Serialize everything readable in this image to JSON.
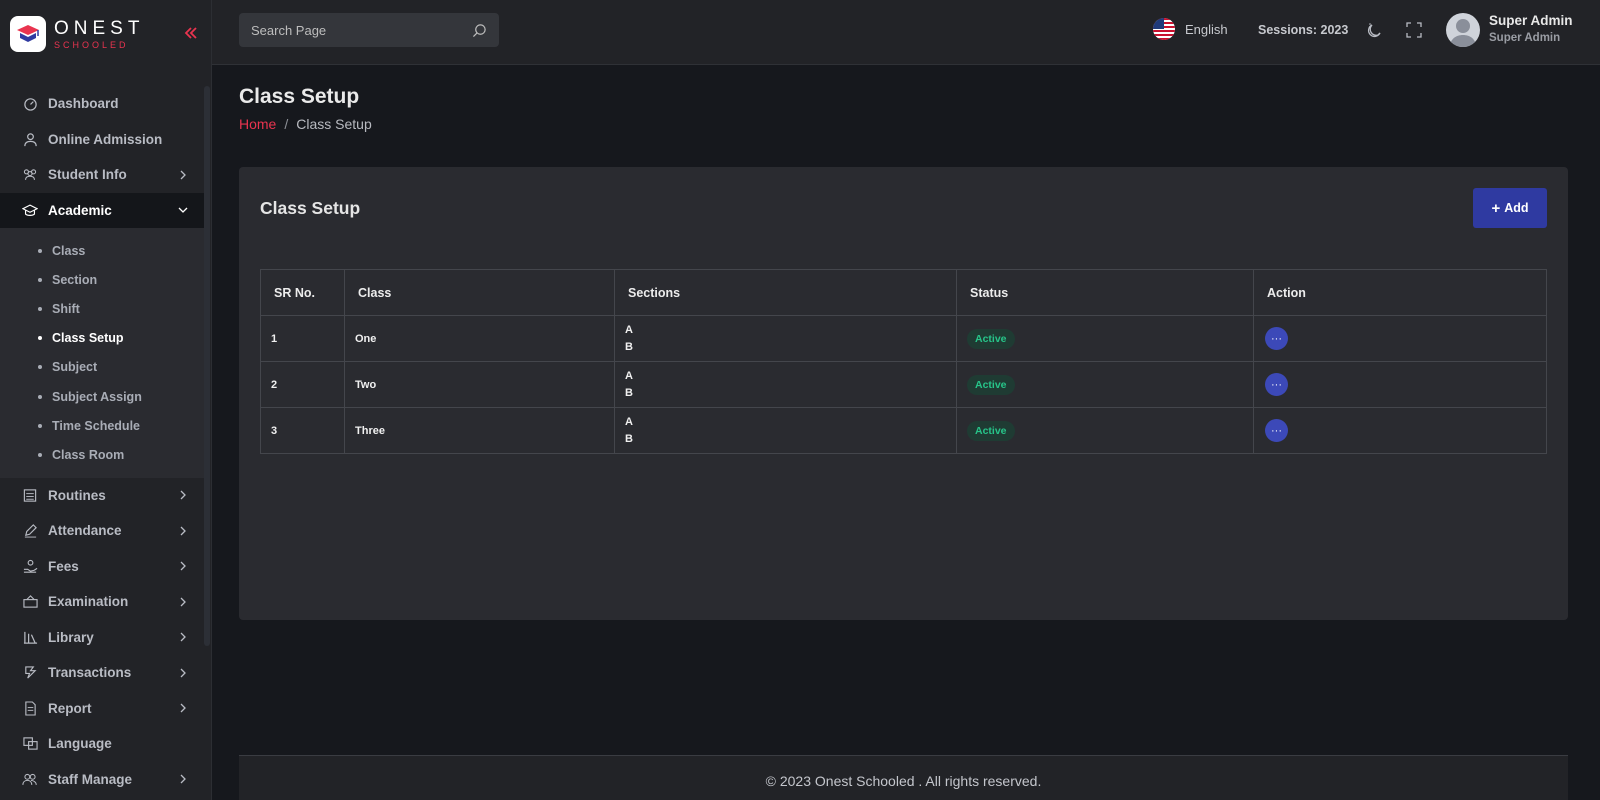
{
  "brand": {
    "name": "ONEST",
    "tagline": "SCHOOLED",
    "accent": "#e9344f"
  },
  "sidebar": {
    "items": [
      {
        "label": "Dashboard",
        "icon": "dashboard-icon",
        "has_children": false
      },
      {
        "label": "Online Admission",
        "icon": "user-icon",
        "has_children": false
      },
      {
        "label": "Student Info",
        "icon": "students-icon",
        "has_children": true
      },
      {
        "label": "Academic",
        "icon": "graduation-cap-icon",
        "has_children": true,
        "expanded": true
      },
      {
        "label": "Routines",
        "icon": "routine-icon",
        "has_children": true
      },
      {
        "label": "Attendance",
        "icon": "pen-icon",
        "has_children": true
      },
      {
        "label": "Fees",
        "icon": "fees-icon",
        "has_children": true
      },
      {
        "label": "Examination",
        "icon": "exam-icon",
        "has_children": true
      },
      {
        "label": "Library",
        "icon": "library-icon",
        "has_children": true
      },
      {
        "label": "Transactions",
        "icon": "transactions-icon",
        "has_children": true
      },
      {
        "label": "Report",
        "icon": "report-icon",
        "has_children": true
      },
      {
        "label": "Language",
        "icon": "language-icon",
        "has_children": false
      },
      {
        "label": "Staff Manage",
        "icon": "staff-icon",
        "has_children": true
      }
    ],
    "academic_sub": [
      "Class",
      "Section",
      "Shift",
      "Class Setup",
      "Subject",
      "Subject Assign",
      "Time Schedule",
      "Class Room"
    ],
    "active_sub": "Class Setup"
  },
  "header": {
    "search_placeholder": "Search Page",
    "language": "English",
    "sessions": "Sessions: 2023",
    "user_name": "Super Admin",
    "user_role": "Super Admin"
  },
  "page": {
    "title": "Class Setup",
    "breadcrumb_home": "Home",
    "breadcrumb_current": "Class Setup"
  },
  "card": {
    "title": "Class Setup",
    "add_label": "Add",
    "columns": [
      "SR No.",
      "Class",
      "Sections",
      "Status",
      "Action"
    ],
    "rows": [
      {
        "sr": "1",
        "class": "One",
        "sections": [
          "A",
          "B"
        ],
        "status": "Active"
      },
      {
        "sr": "2",
        "class": "Two",
        "sections": [
          "A",
          "B"
        ],
        "status": "Active"
      },
      {
        "sr": "3",
        "class": "Three",
        "sections": [
          "A",
          "B"
        ],
        "status": "Active"
      }
    ],
    "action_label": "···"
  },
  "footer": {
    "text": "© 2023 Onest Schooled . All rights reserved."
  },
  "colors": {
    "primary": "#2f3aa1",
    "status_active": "#27c489",
    "brand_red": "#e9344f"
  }
}
